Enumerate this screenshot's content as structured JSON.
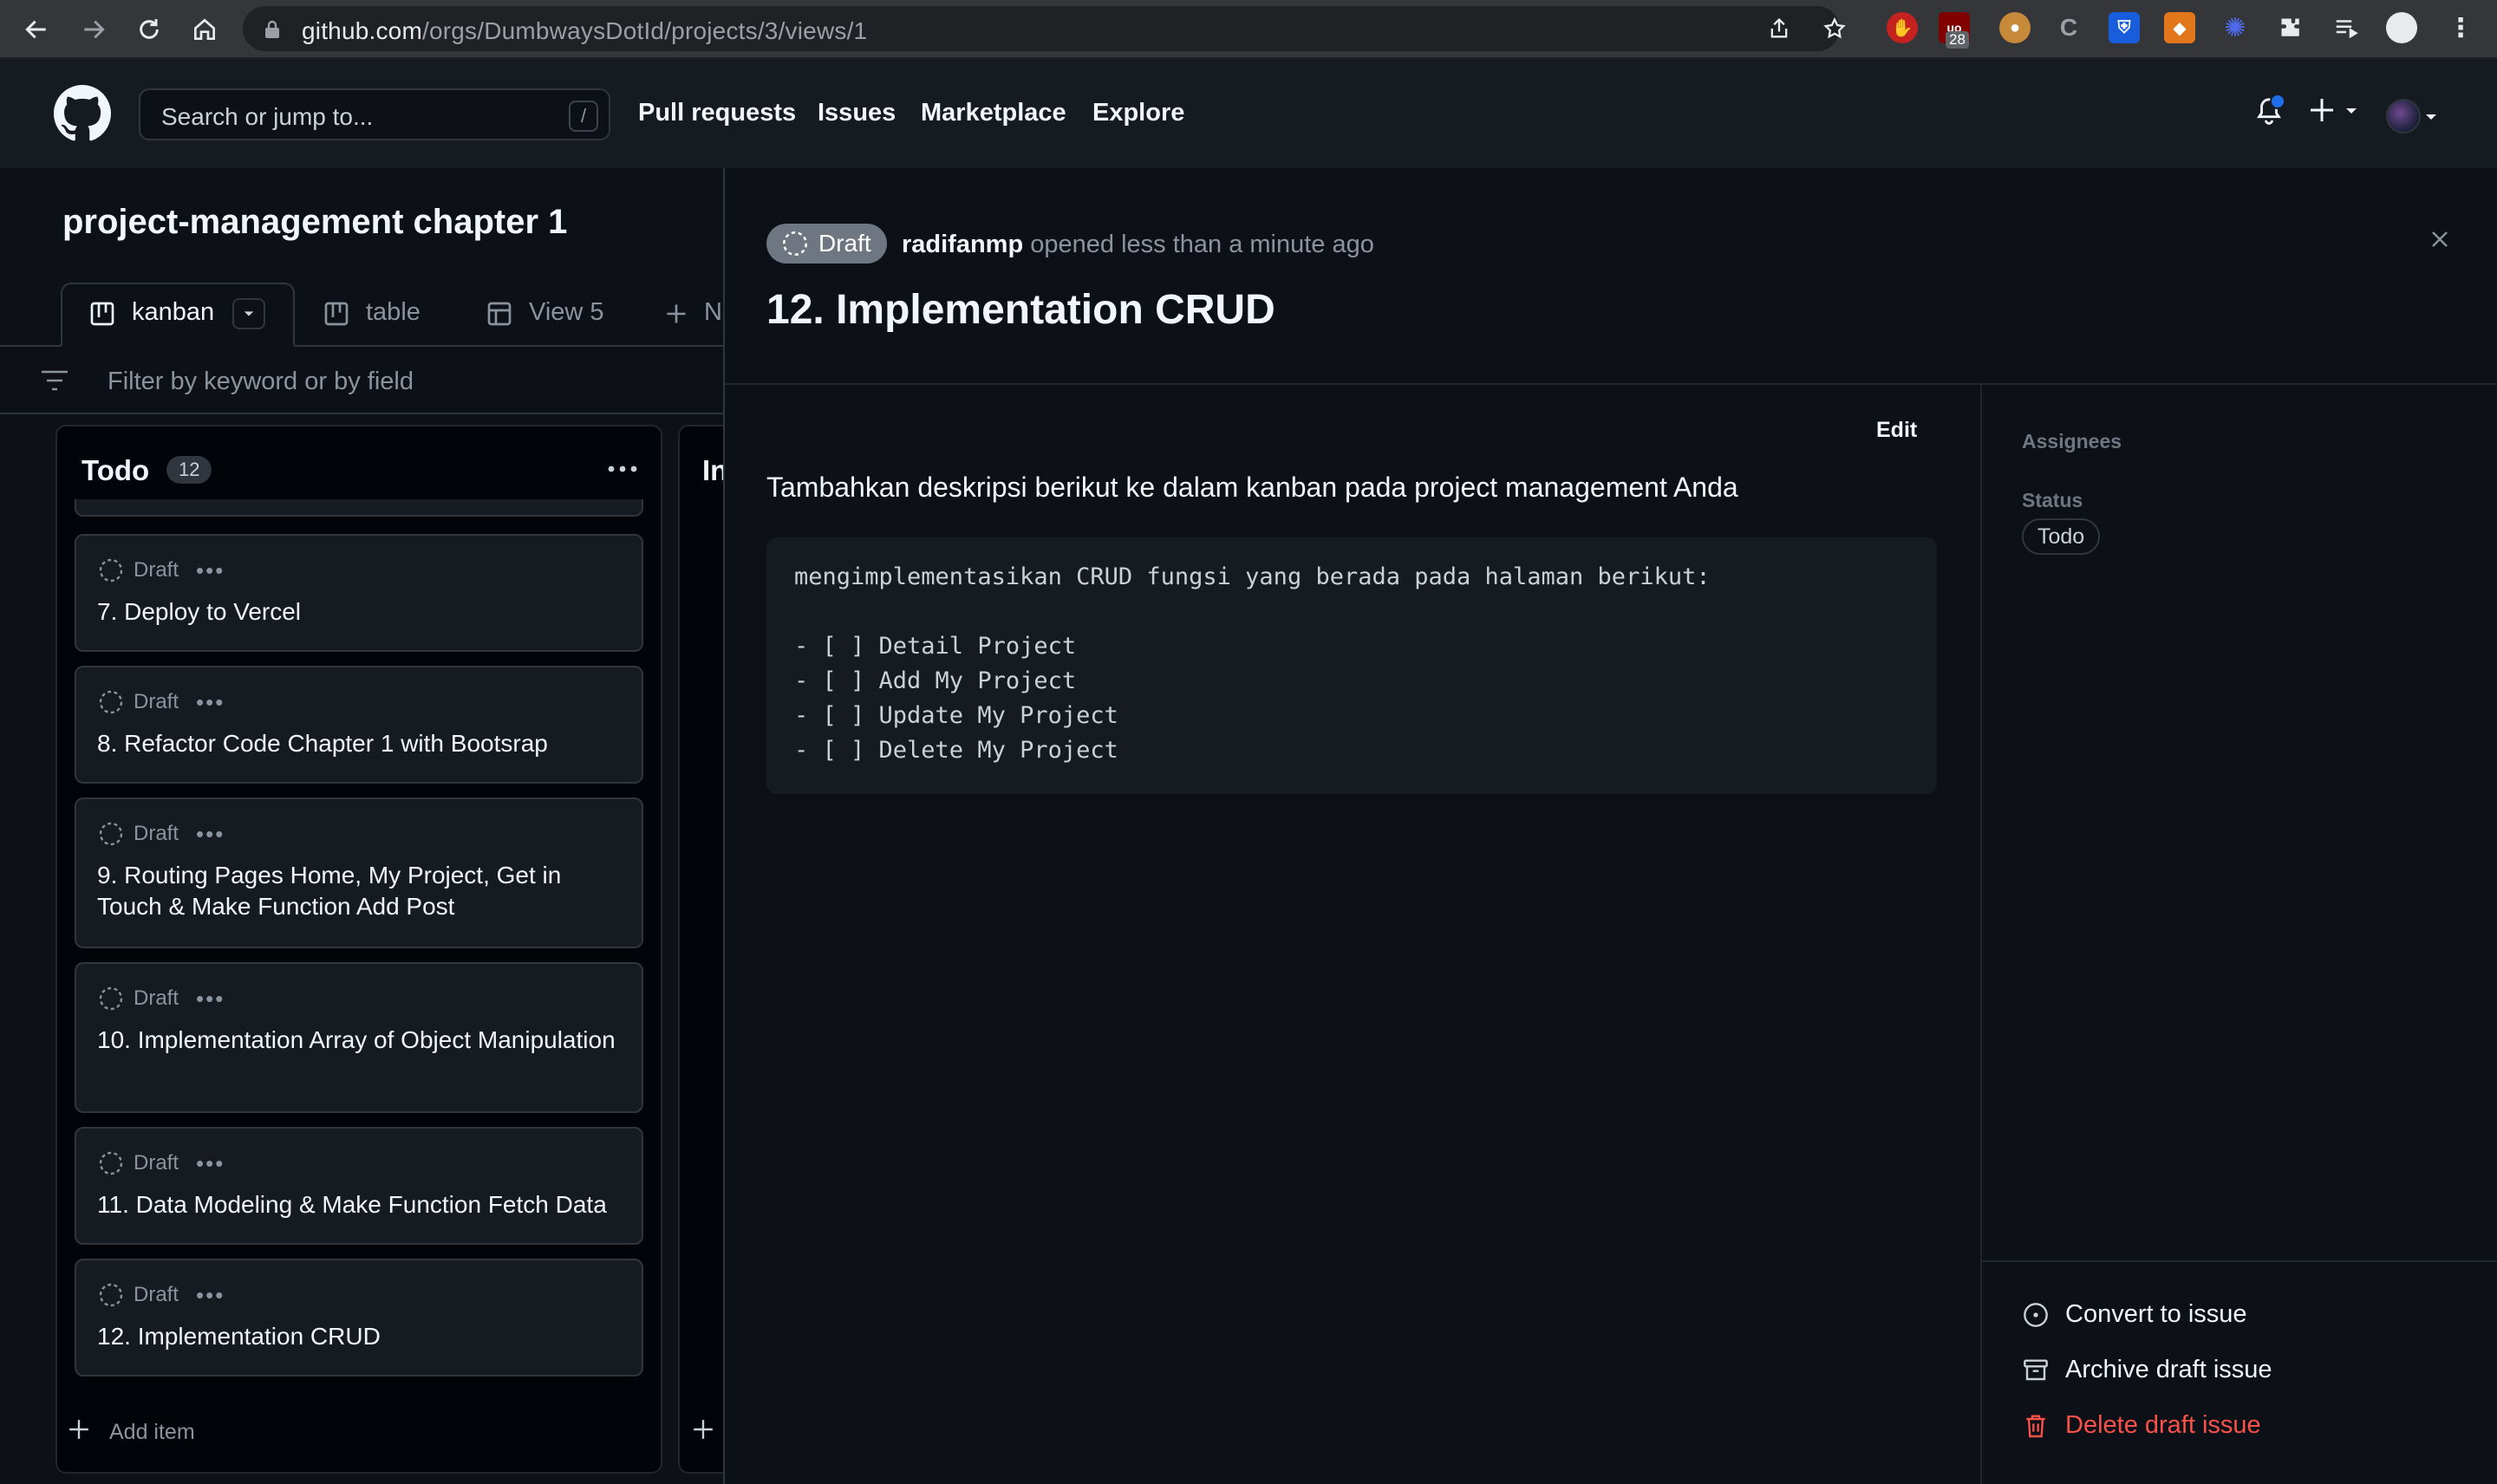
{
  "browser": {
    "url_host": "github.com",
    "url_path": "/orgs/DumbwaysDotId/projects/3/views/1",
    "extension_badge": "28"
  },
  "header": {
    "search_placeholder": "Search or jump to...",
    "search_shortcut": "/",
    "nav": [
      "Pull requests",
      "Issues",
      "Marketplace",
      "Explore"
    ]
  },
  "project": {
    "title": "project-management chapter 1",
    "tabs": [
      {
        "label": "kanban",
        "icon": "board-icon"
      },
      {
        "label": "table",
        "icon": "board-icon"
      },
      {
        "label": "View 5",
        "icon": "table-icon"
      },
      {
        "label": "N",
        "icon": "plus-icon"
      }
    ],
    "filter_placeholder": "Filter by keyword or by field"
  },
  "columns": [
    {
      "title": "Todo",
      "count": "12",
      "cards": [
        {
          "state": "Draft",
          "title": "7. Deploy to Vercel"
        },
        {
          "state": "Draft",
          "title": "8. Refactor Code Chapter 1 with Bootsrap"
        },
        {
          "state": "Draft",
          "title": "9. Routing Pages Home, My Project, Get in Touch & Make Function Add Post"
        },
        {
          "state": "Draft",
          "title": "10. Implementation Array of Object Manipulation"
        },
        {
          "state": "Draft",
          "title": "11. Data Modeling & Make Function Fetch Data"
        },
        {
          "state": "Draft",
          "title": "12. Implementation CRUD"
        }
      ],
      "add_item": "Add item"
    },
    {
      "title": "In"
    }
  ],
  "panel": {
    "state": "Draft",
    "author": "radifanmp",
    "opened_text": "opened less than a minute ago",
    "title": "12. Implementation CRUD",
    "edit_label": "Edit",
    "description": "Tambahkan deskripsi berikut ke dalam kanban pada project management Anda",
    "code": "mengimplementasikan CRUD fungsi yang berada pada halaman berikut:\n\n- [ ] Detail Project\n- [ ] Add My Project\n- [ ] Update My Project\n- [ ] Delete My Project",
    "sidebar": {
      "assignees_label": "Assignees",
      "status_label": "Status",
      "status_value": "Todo"
    },
    "actions": {
      "convert": "Convert to issue",
      "archive": "Archive draft issue",
      "delete": "Delete draft issue"
    }
  },
  "colors": {
    "background": "#0d1117",
    "header": "#161b22",
    "border": "#30363d",
    "danger": "#f85149",
    "accent": "#1f6feb"
  }
}
